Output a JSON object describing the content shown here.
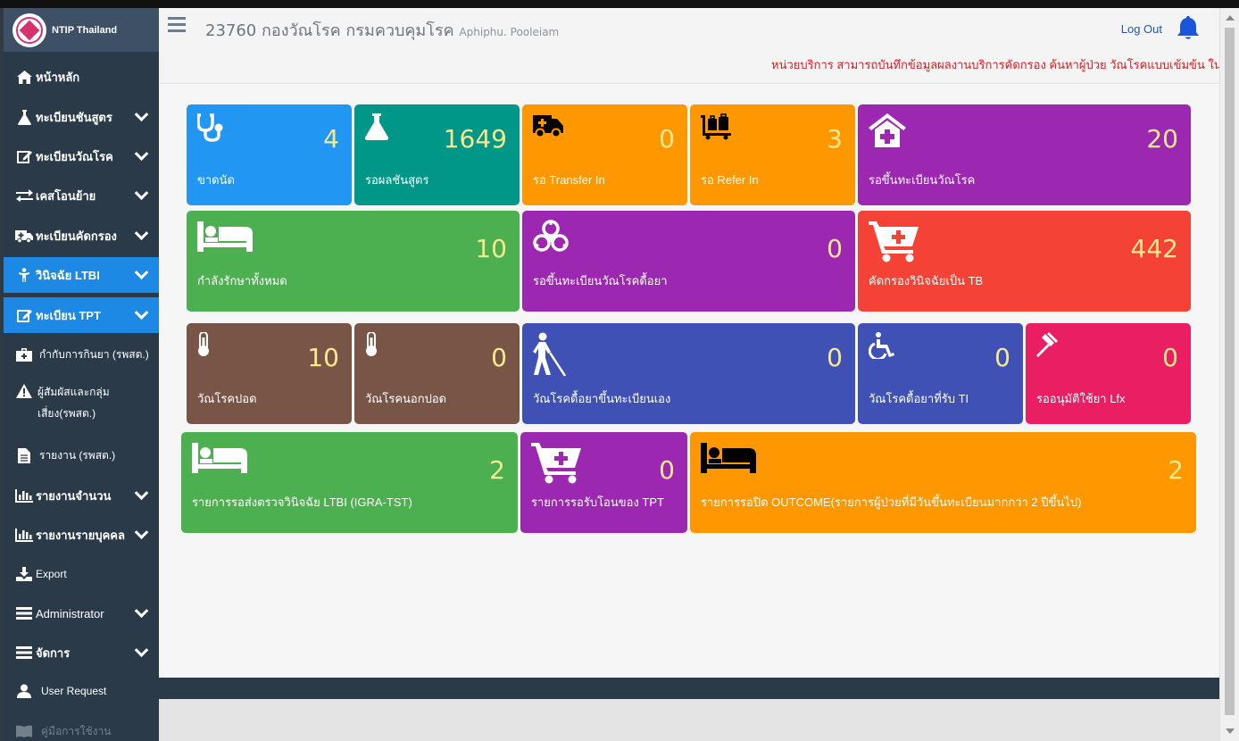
{
  "brand": {
    "name": "NTIP Thailand"
  },
  "header": {
    "title": "23760 กองวัณโรค กรมควบคุมโรค",
    "user": "Aphiphu. Pooleiam",
    "logout": "Log Out",
    "notice": "หน่วยบริการ สามารถบันทึกข้อมูลผลงานบริการคัดกรอง ค้นหาผู้ป่วย วัณโรคแบบเข้มข้น ในกลุ่มเสี่"
  },
  "sidebar": {
    "items": [
      {
        "label": "หน้าหลัก",
        "icon": "home-icon"
      },
      {
        "label": "ทะเบียนชันสูตร",
        "icon": "flask-icon"
      },
      {
        "label": "ทะเบียนวัณโรค",
        "icon": "edit-icon"
      },
      {
        "label": "เคสโอนย้าย",
        "icon": "transfer-icon"
      },
      {
        "label": "ทะเบียนคัดกรอง",
        "icon": "ambulance-icon"
      },
      {
        "label": "วินิจฉัย LTBI",
        "icon": "child-icon"
      },
      {
        "label": "ทะเบียน TPT",
        "icon": "edit-icon"
      },
      {
        "label": "กำกับการกินยา (รพสต.)",
        "icon": "medkit-icon"
      },
      {
        "label": "ผู้สัมผัสและกลุ่มเสี่ยง(รพสต.)",
        "icon": "warning-icon"
      },
      {
        "label": "รายงาน (รพสต.)",
        "icon": "file-icon"
      },
      {
        "label": "รายงานจำนวน",
        "icon": "bar-chart-icon"
      },
      {
        "label": "รายงานรายบุคคล",
        "icon": "bar-chart-icon"
      },
      {
        "label": "Export",
        "icon": "download-icon"
      },
      {
        "label": "Administrator",
        "icon": "menu-icon"
      },
      {
        "label": "จัดการ",
        "icon": "menu-icon"
      },
      {
        "label": "User Request",
        "icon": "user-icon"
      },
      {
        "label": "คู่มือการใช้งาน",
        "icon": "book-icon"
      }
    ]
  },
  "tiles": [
    {
      "value": "4",
      "label": "ขาดนัด",
      "color": "#2196f3",
      "icon": "stethoscope-icon"
    },
    {
      "value": "1649",
      "label": "รอผลชันสูตร",
      "color": "#009688",
      "icon": "flask-icon"
    },
    {
      "value": "0",
      "label": "รอ Transfer In",
      "color": "#ff9800",
      "icon": "truck-icon"
    },
    {
      "value": "3",
      "label": "รอ Refer In",
      "color": "#ff9800",
      "icon": "luggage-cart-icon"
    },
    {
      "value": "20",
      "label": "รอขึ้นทะเบียนวัณโรค",
      "color": "#9c27b0",
      "icon": "clinic-icon"
    },
    {
      "value": "10",
      "label": "กำลังรักษาทั้งหมด",
      "color": "#4caf50",
      "icon": "bed-icon"
    },
    {
      "value": "0",
      "label": "รอขึ้นทะเบียนวัณโรคดื้อยา",
      "color": "#9c27b0",
      "icon": "biohazard-icon"
    },
    {
      "value": "442",
      "label": "คัดกรองวินิจฉัยเป็น TB",
      "color": "#f44336",
      "icon": "cart-plus-icon"
    },
    {
      "value": "10",
      "label": "วัณโรคปอด",
      "color": "#795548",
      "icon": "thermometer-icon"
    },
    {
      "value": "0",
      "label": "วัณโรคนอกปอด",
      "color": "#795548",
      "icon": "thermometer-icon"
    },
    {
      "value": "0",
      "label": "วัณโรคดื้อยาขึ้นทะเบียนเอง",
      "color": "#3f51b5",
      "icon": "blind-icon"
    },
    {
      "value": "0",
      "label": "วัณโรคดื้อยาที่รับ TI",
      "color": "#3f51b5",
      "icon": "wheelchair-icon"
    },
    {
      "value": "0",
      "label": "รออนุมัติใช้ยา Lfx",
      "color": "#e91e63",
      "icon": "gavel-icon"
    },
    {
      "value": "2",
      "label": "รายการรอส่งตรวจวินิจฉัย LTBI (IGRA-TST)",
      "color": "#4caf50",
      "icon": "bed-icon"
    },
    {
      "value": "0",
      "label": "รายการรอรับโอนของ TPT",
      "color": "#9c27b0",
      "icon": "cart-plus-icon"
    },
    {
      "value": "2",
      "label": "รายการรอปิด OUTCOME(รายการผู้ป่วยที่มีวันขึ้นทะเบียนมากกว่า 2 ปีขึ้นไป)",
      "color": "#ff9800",
      "icon": "bed-icon"
    }
  ]
}
